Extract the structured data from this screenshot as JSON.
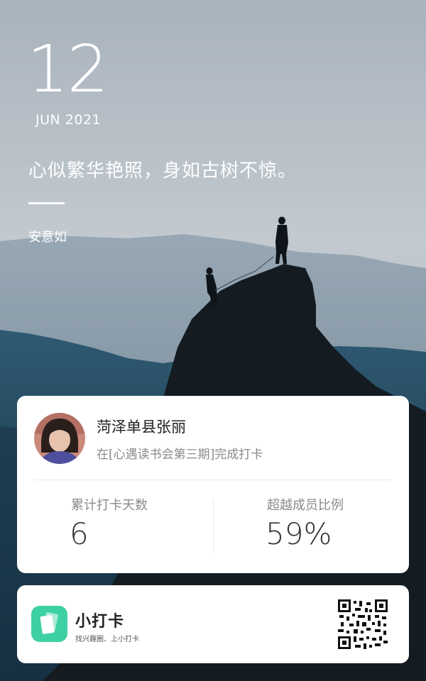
{
  "date": {
    "day": "12",
    "month_year": "JUN 2021"
  },
  "quote": "心似繁华艳照，身如古树不惊。",
  "author": "安意如",
  "user": {
    "name": "菏泽单县张丽",
    "checkin_text": "在[心遇读书会第三期]完成打卡"
  },
  "stats": [
    {
      "label": "累计打卡天数",
      "value": "6"
    },
    {
      "label": "超越成员比例",
      "value": "59%"
    }
  ],
  "brand": {
    "name": "小打卡",
    "slogan": "找兴趣圈、上小打卡"
  },
  "colors": {
    "accent": "#3dd0a4",
    "card_bg": "#ffffff",
    "text_dark": "#222222",
    "text_muted": "#8a8a8a"
  }
}
